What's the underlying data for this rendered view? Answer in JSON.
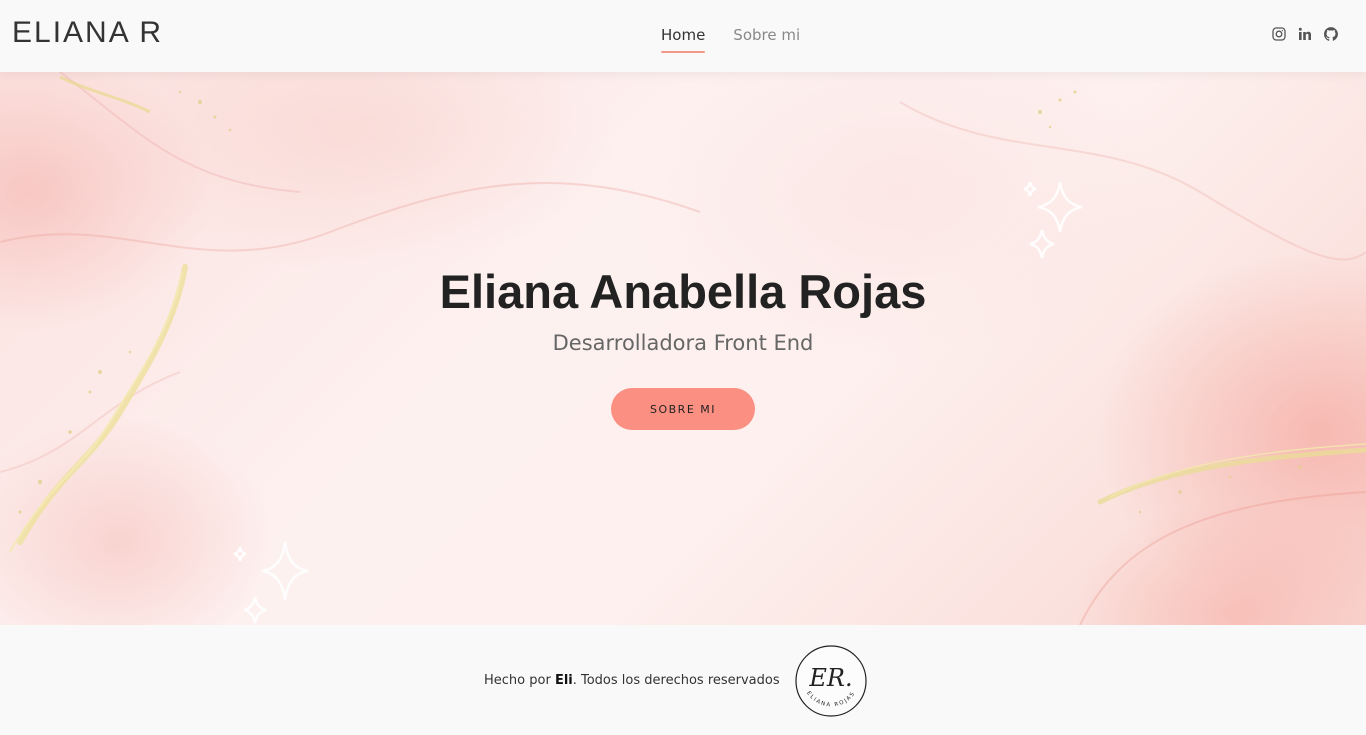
{
  "header": {
    "brand": "ELIANA R",
    "nav": [
      {
        "label": "Home",
        "active": true
      },
      {
        "label": "Sobre mi",
        "active": false
      }
    ],
    "social": [
      {
        "name": "instagram-icon"
      },
      {
        "name": "linkedin-icon"
      },
      {
        "name": "github-icon"
      }
    ]
  },
  "hero": {
    "title": "Eliana Anabella Rojas",
    "subtitle": "Desarrolladora Front End",
    "button_label": "SOBRE MI"
  },
  "footer": {
    "prefix": "Hecho por ",
    "author": "Eli",
    "suffix": ". Todos los derechos reservados",
    "logo": {
      "initials": "ER.",
      "name": "ELIANA ROJAS"
    }
  },
  "colors": {
    "accent": "#fa8f82",
    "underline": "#f3998a",
    "gold": "#e8d98a"
  }
}
